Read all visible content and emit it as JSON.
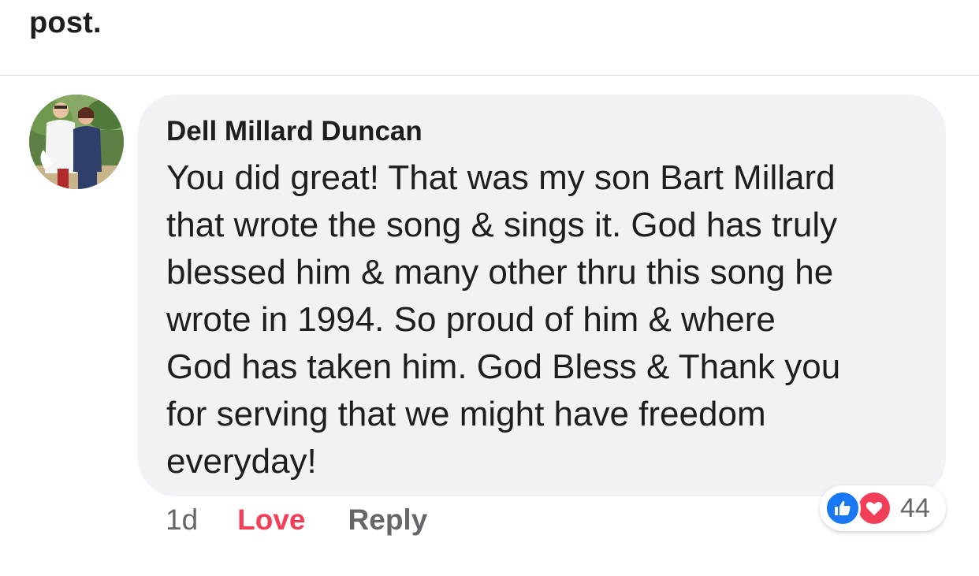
{
  "post": {
    "tail_text": "post."
  },
  "comment": {
    "author": "Dell Millard Duncan",
    "text": "You did great! That was my son Bart Millard\nthat wrote the song & sings it. God has truly\nblessed him & many other thru this song he\nwrote in 1994. So proud of him & where\nGod has taken him.  God Bless & Thank you\nfor serving that we might have freedom\neveryday!",
    "timestamp": "1d",
    "love_label": "Love",
    "reply_label": "Reply",
    "reactions": {
      "icons": [
        "like-icon",
        "love-icon"
      ],
      "count": "44"
    }
  },
  "colors": {
    "bubble_bg": "#f0f2f5",
    "love_accent": "#f33e58",
    "like_blue": "#1877f2",
    "secondary_text": "#65676b"
  }
}
